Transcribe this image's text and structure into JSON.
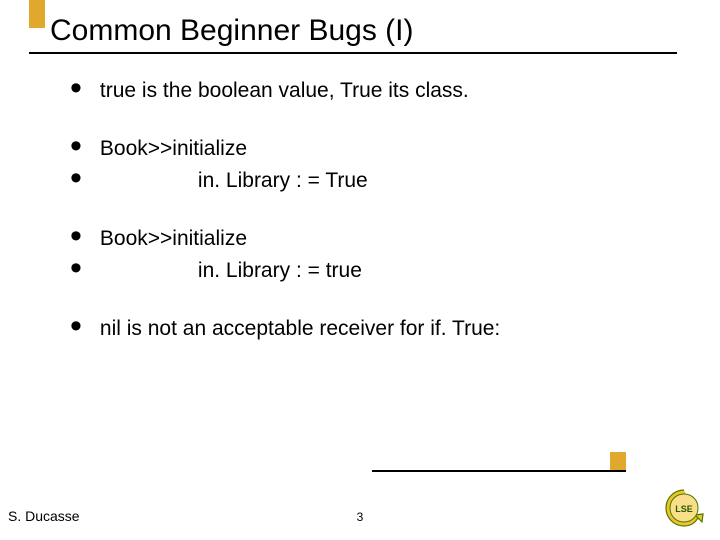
{
  "title": "Common Beginner Bugs (I)",
  "bullets": {
    "b1": "true is the boolean value,  True its class.",
    "b2": "Book>>initialize",
    "b3": "in. Library : = True",
    "b4": "Book>>initialize",
    "b5": "in. Library : = true",
    "b6": "nil is not an acceptable receiver for if. True:"
  },
  "footer": {
    "author": "S. Ducasse",
    "page": "3"
  },
  "colors": {
    "accent": "#e0a92e"
  }
}
